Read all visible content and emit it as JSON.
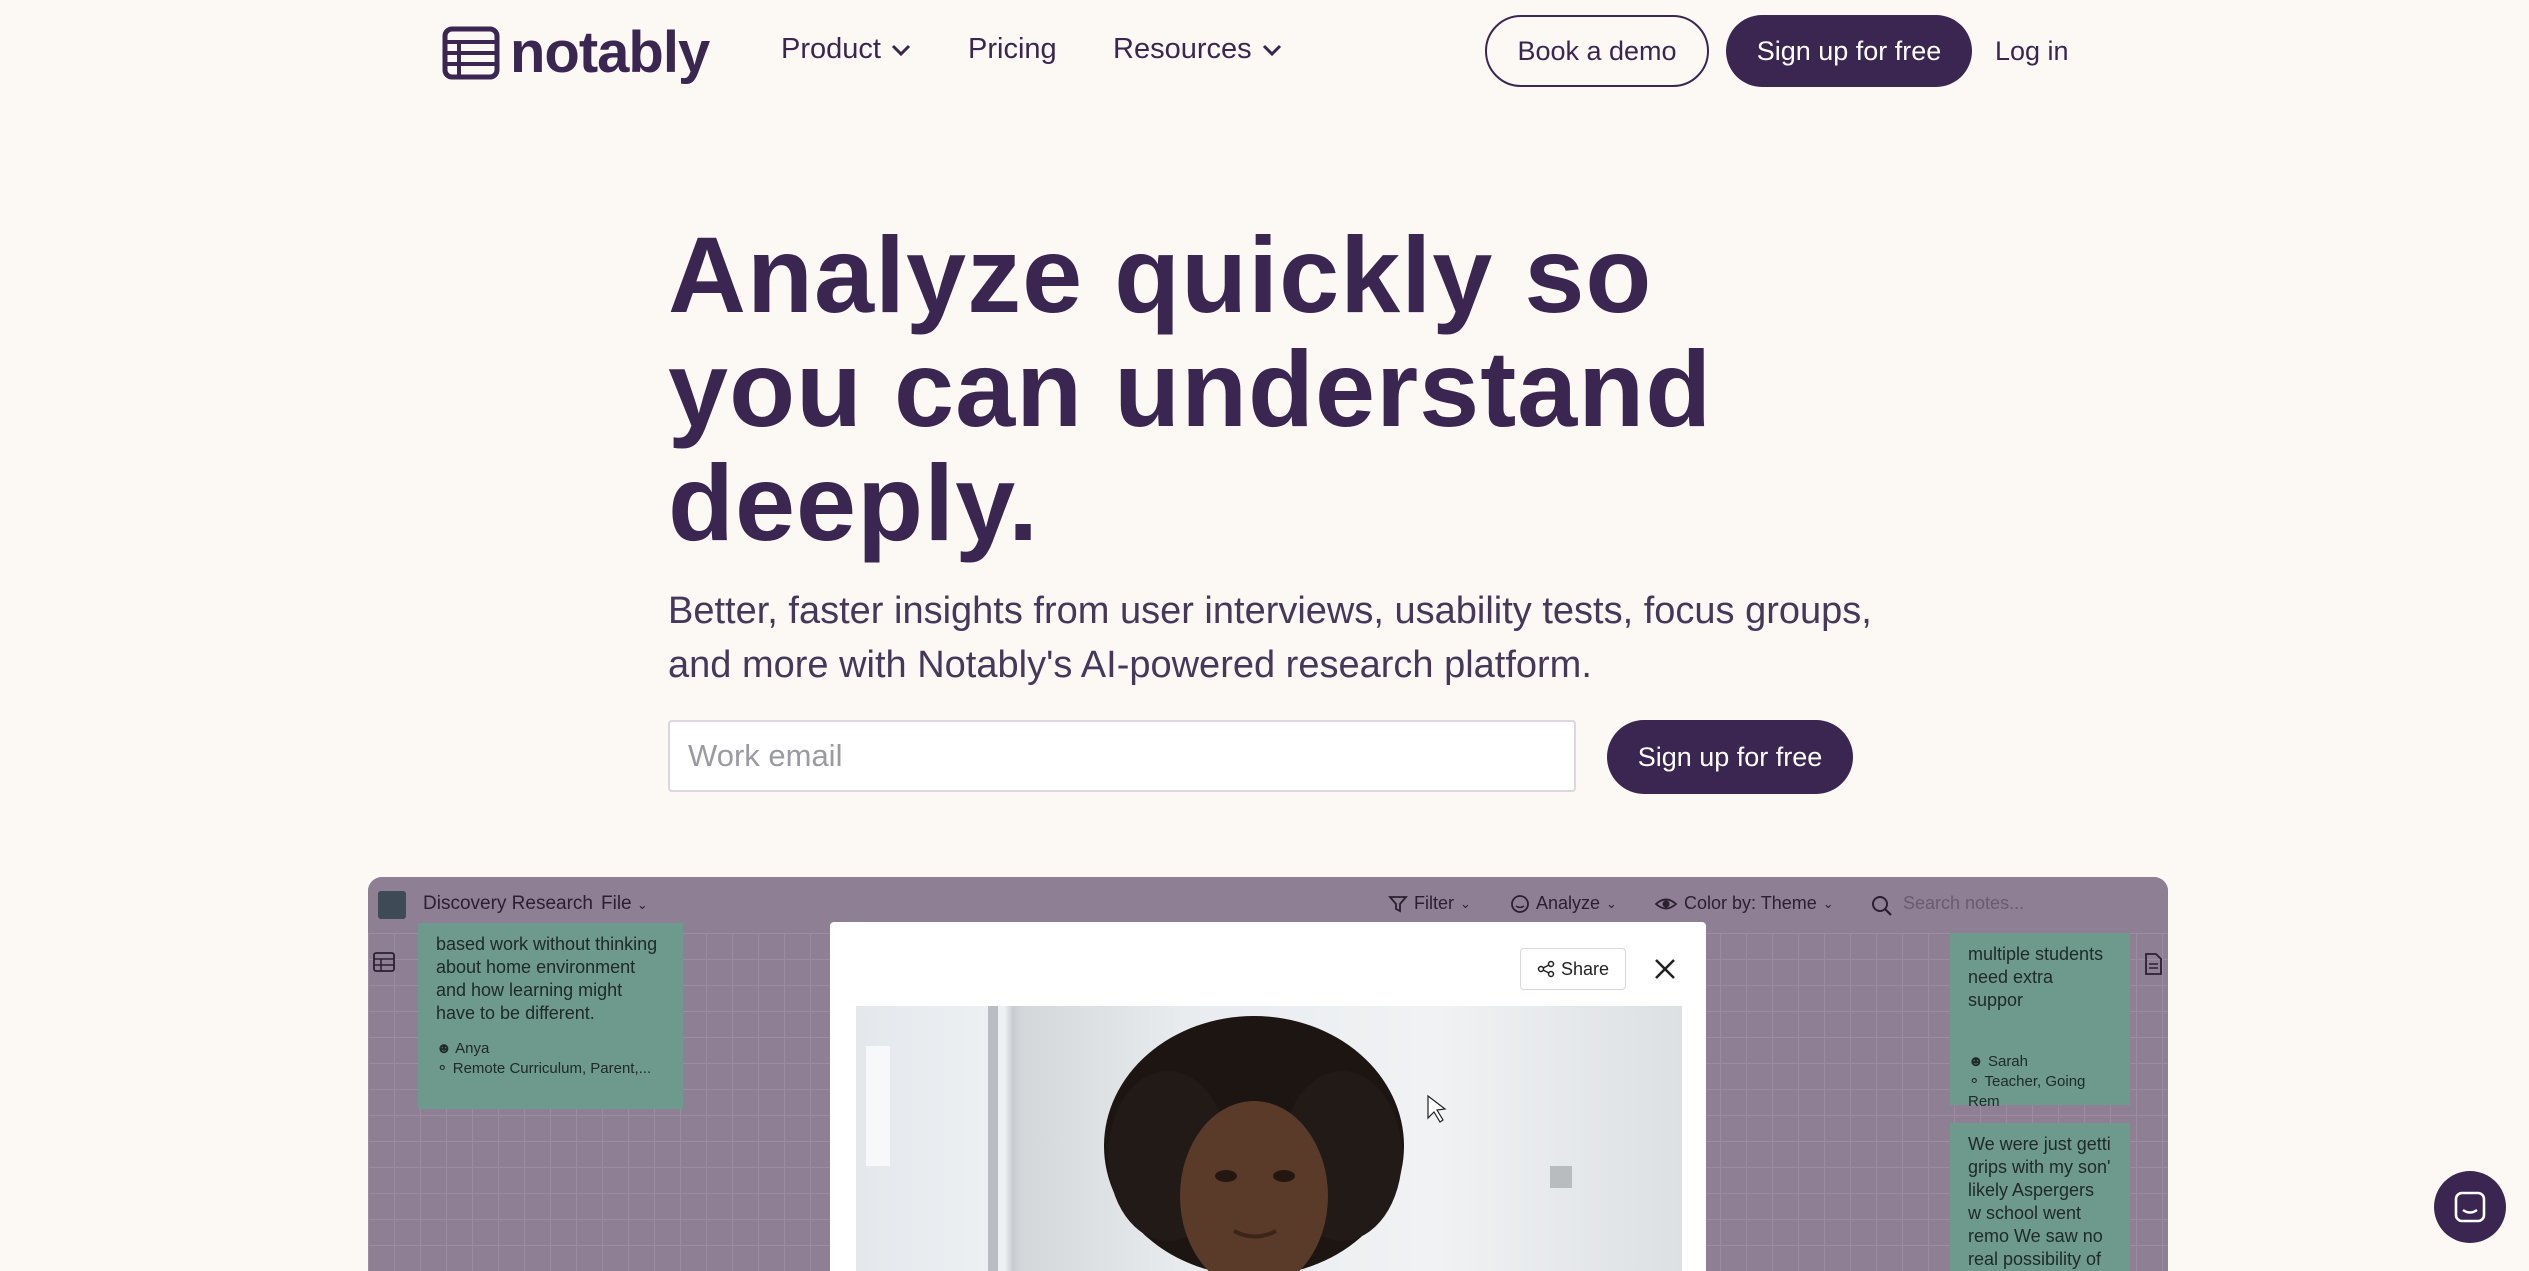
{
  "nav": {
    "logo_text": "notably",
    "items": [
      {
        "label": "Product",
        "has_dropdown": true
      },
      {
        "label": "Pricing",
        "has_dropdown": false
      },
      {
        "label": "Resources",
        "has_dropdown": true
      }
    ],
    "book_demo": "Book a demo",
    "signup": "Sign up for free",
    "login": "Log in"
  },
  "hero": {
    "title_line1": "Analyze quickly so",
    "title_line2": "you can understand",
    "title_line3": "deeply.",
    "subtitle": "Better, faster insights from user interviews, usability tests, focus groups, and more with Notably's AI-powered research platform.",
    "email_placeholder": "Work email",
    "signup": "Sign up for free"
  },
  "preview": {
    "project_title": "Discovery Research",
    "file_menu": "File",
    "toolbar": {
      "filter": "Filter",
      "analyze": "Analyze",
      "color_by": "Color by: Theme",
      "search_placeholder": "Search notes..."
    },
    "left_card": {
      "text": "based work without thinking about home environment and how learning might have to be different.",
      "author": "Anya",
      "tags": "Remote Curriculum, Parent,..."
    },
    "right_card_1": {
      "text": "multiple students need extra suppor",
      "author": "Sarah",
      "tags": "Teacher, Going Rem"
    },
    "right_card_2": {
      "text": "We were just getti grips with my son' likely Aspergers w school went remo We saw no real possibility of givin"
    },
    "modal": {
      "share": "Share"
    }
  },
  "colors": {
    "brand": "#3a2650",
    "background": "#fcf9f5",
    "card": "#6e9a8d"
  }
}
